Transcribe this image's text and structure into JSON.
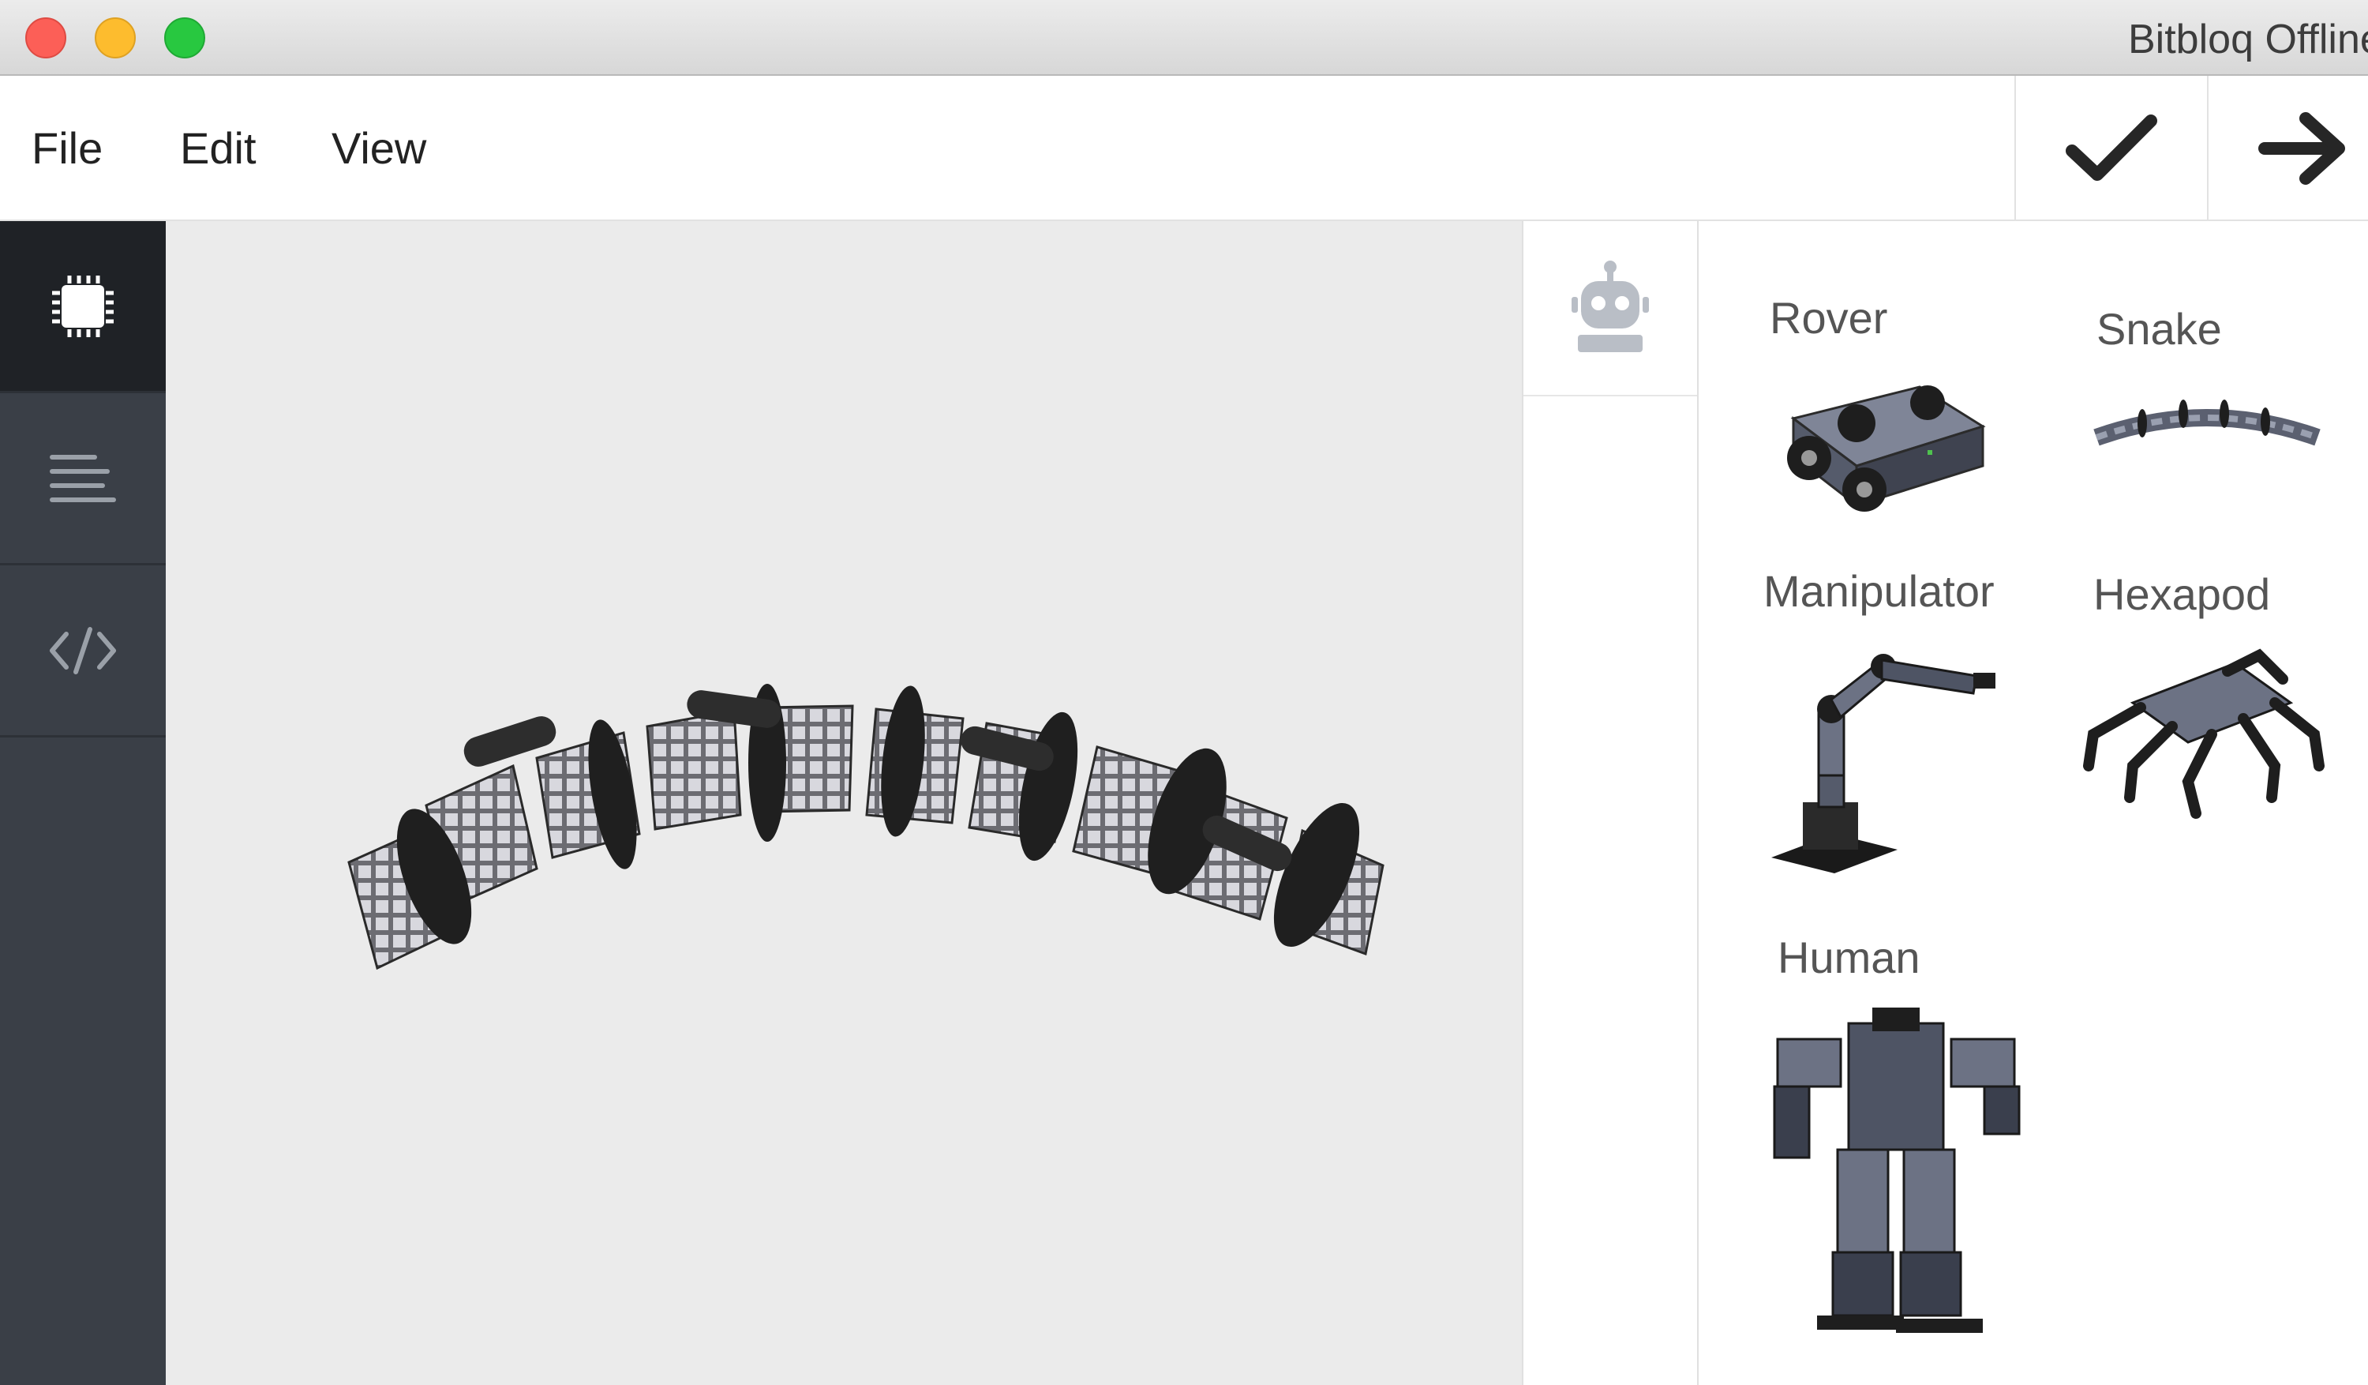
{
  "window": {
    "title": "Bitbloq Offline",
    "controls": [
      "close",
      "minimize",
      "zoom"
    ]
  },
  "menu": {
    "file": "File",
    "edit": "Edit",
    "view": "View"
  },
  "toolbar": {
    "verify_icon": "checkmark-icon",
    "upload_icon": "arrow-right-icon"
  },
  "sidebar": {
    "items": [
      {
        "icon": "chip-icon",
        "active": true
      },
      {
        "icon": "bloqs-icon",
        "active": false
      },
      {
        "icon": "code-icon",
        "active": false
      }
    ]
  },
  "component_tabs": {
    "items": [
      {
        "icon": "robot-icon",
        "active": true
      }
    ]
  },
  "robots": {
    "items": [
      {
        "name": "Rover"
      },
      {
        "name": "Snake"
      },
      {
        "name": "Manipulator"
      },
      {
        "name": "Hexapod"
      },
      {
        "name": "Human"
      }
    ]
  },
  "colors": {
    "sidebar": "#3a3f47",
    "sidebar_active": "#1f2226",
    "viewport": "#ebebeb",
    "traffic_red": "#fc5f57",
    "traffic_yellow": "#fdbc2e",
    "traffic_green": "#28c840"
  }
}
